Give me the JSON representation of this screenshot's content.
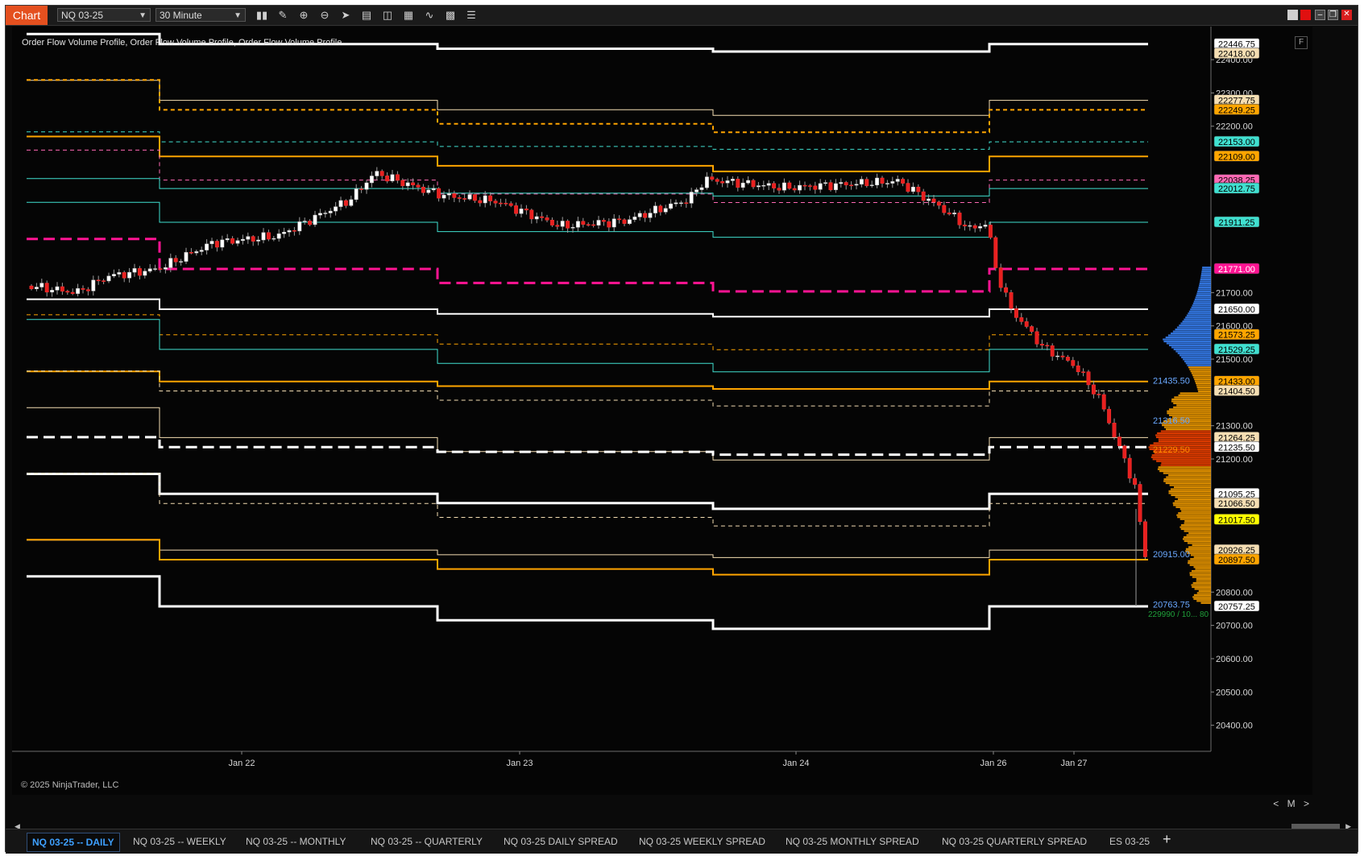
{
  "toolbar": {
    "title": "Chart",
    "instrument": "NQ 03-25",
    "interval": "30 Minute",
    "icons": [
      "bar-type-icon",
      "draw-tools-icon",
      "zoom-in-icon",
      "zoom-out-icon",
      "pointer-icon",
      "data-box-icon",
      "templates-icon",
      "properties-icon",
      "strategies-icon",
      "indicators-icon",
      "chart-trader-icon"
    ]
  },
  "indicator_label": "Order Flow Volume Profile, Order Flow Volume Profile, Order Flow Volume Profile",
  "copyright": "© 2025 NinjaTrader, LLC",
  "f_button": "F",
  "nav_buttons": [
    "<",
    "M",
    ">"
  ],
  "tabs": [
    {
      "label": "NQ 03-25 -- DAILY",
      "active": true
    },
    {
      "label": "NQ 03-25 -- WEEKLY",
      "active": false
    },
    {
      "label": "NQ 03-25 -- MONTHLY",
      "active": false
    },
    {
      "label": "NQ 03-25 -- QUARTERLY",
      "active": false
    },
    {
      "label": "NQ 03-25 DAILY SPREAD",
      "active": false
    },
    {
      "label": "NQ 03-25 WEEKLY SPREAD",
      "active": false
    },
    {
      "label": "NQ 03-25 MONTHLY SPREAD",
      "active": false
    },
    {
      "label": "NQ 03-25 QUARTERLY SPREAD",
      "active": false
    },
    {
      "label": "ES 03-25",
      "active": false
    }
  ],
  "add_tab": "+",
  "chart_data": {
    "type": "candlestick",
    "instrument": "NQ 03-25",
    "interval": "30 Minute",
    "ylim": [
      20370,
      22480
    ],
    "y_ticks": [
      22400.0,
      22300.0,
      22200.0,
      21700.0,
      21600.0,
      21500.0,
      21300.0,
      21200.0,
      20800.0,
      20700.0,
      20600.0,
      20500.0,
      20400.0
    ],
    "x_labels": [
      "Jan 22",
      "Jan 23",
      "Jan 24",
      "Jan 26",
      "Jan 27"
    ],
    "price_markers": [
      {
        "label": "22446.75",
        "value": 22446.75,
        "bg": "#ffffff",
        "fg": "#000000"
      },
      {
        "label": "22418.00",
        "value": 22418.0,
        "bg": "#f5deb3",
        "fg": "#000000"
      },
      {
        "label": "22277.75",
        "value": 22277.75,
        "bg": "#f5deb3",
        "fg": "#000000"
      },
      {
        "label": "22249.25",
        "value": 22249.25,
        "bg": "#ffa500",
        "fg": "#000000"
      },
      {
        "label": "22153.00",
        "value": 22153.0,
        "bg": "#40e0d0",
        "fg": "#000000"
      },
      {
        "label": "22109.00",
        "value": 22109.0,
        "bg": "#ffa500",
        "fg": "#000000"
      },
      {
        "label": "22038.25",
        "value": 22038.25,
        "bg": "#ff69b4",
        "fg": "#000000"
      },
      {
        "label": "22012.75",
        "value": 22012.75,
        "bg": "#40e0d0",
        "fg": "#000000"
      },
      {
        "label": "21911.25",
        "value": 21911.25,
        "bg": "#40e0d0",
        "fg": "#000000"
      },
      {
        "label": "21771.00",
        "value": 21771.0,
        "bg": "#ff1493",
        "fg": "#ffffff"
      },
      {
        "label": "21650.00",
        "value": 21650.0,
        "bg": "#ffffff",
        "fg": "#000000"
      },
      {
        "label": "21573.25",
        "value": 21573.25,
        "bg": "#ffa500",
        "fg": "#000000"
      },
      {
        "label": "21529.25",
        "value": 21529.25,
        "bg": "#40e0d0",
        "fg": "#000000"
      },
      {
        "label": "21433.00",
        "value": 21433.0,
        "bg": "#ffa500",
        "fg": "#000000"
      },
      {
        "label": "21404.50",
        "value": 21404.5,
        "bg": "#f5deb3",
        "fg": "#000000"
      },
      {
        "label": "21264.25",
        "value": 21264.25,
        "bg": "#f5deb3",
        "fg": "#000000"
      },
      {
        "label": "21235.50",
        "value": 21235.5,
        "bg": "#ffffff",
        "fg": "#000000"
      },
      {
        "label": "21095.25",
        "value": 21095.25,
        "bg": "#ffffff",
        "fg": "#000000"
      },
      {
        "label": "21066.50",
        "value": 21066.5,
        "bg": "#f5deb3",
        "fg": "#000000"
      },
      {
        "label": "21017.50",
        "value": 21017.5,
        "bg": "#ffff00",
        "fg": "#000000"
      },
      {
        "label": "20926.25",
        "value": 20926.25,
        "bg": "#f5deb3",
        "fg": "#000000"
      },
      {
        "label": "20897.50",
        "value": 20897.5,
        "bg": "#ffa500",
        "fg": "#000000"
      },
      {
        "label": "20757.25",
        "value": 20757.25,
        "bg": "#ffffff",
        "fg": "#000000"
      }
    ],
    "profile_labels": [
      {
        "label": "21435.50",
        "value": 21435.5,
        "color": "#6aa8ff"
      },
      {
        "label": "21316.50",
        "value": 21316.5,
        "color": "#6aa8ff"
      },
      {
        "label": "21229.50",
        "value": 21229.5,
        "color": "#ff8c00"
      },
      {
        "label": "20915.00",
        "value": 20915.0,
        "color": "#6aa8ff"
      },
      {
        "label": "20763.75",
        "value": 20763.75,
        "color": "#6aa8ff"
      }
    ],
    "volume_summary": "229990 / 10... 80",
    "level_lines": [
      {
        "color": "#ffffff",
        "style": "solid",
        "width": 3,
        "values": [
          22446.75,
          22446.75,
          22446.75,
          22446.75,
          22446.75
        ]
      },
      {
        "color": "#f5deb3",
        "style": "solid",
        "width": 1,
        "values": [
          22277.75,
          22277.75,
          22277.75,
          22277.75,
          22277.75
        ]
      },
      {
        "color": "#ffa500",
        "style": "dashed",
        "width": 2,
        "values": [
          22249.25,
          22249.25,
          22249.25,
          22249.25,
          22249.25
        ]
      },
      {
        "color": "#40e0d0",
        "style": "dashed",
        "width": 1,
        "values": [
          22153.0,
          22153.0,
          22153.0,
          22153.0,
          22153.0
        ]
      },
      {
        "color": "#ffa500",
        "style": "solid",
        "width": 2,
        "values": [
          22109.0,
          22109.0,
          22109.0,
          22109.0,
          22109.0
        ]
      },
      {
        "color": "#ff69b4",
        "style": "dashed",
        "width": 1,
        "values": [
          22038.25,
          22038.25,
          22038.25,
          22038.25,
          22038.25
        ]
      },
      {
        "color": "#40e0d0",
        "style": "solid",
        "width": 1,
        "values": [
          22012.75,
          22012.75,
          22012.75,
          22012.75,
          22012.75
        ]
      },
      {
        "color": "#40e0d0",
        "style": "solid",
        "width": 1,
        "values": [
          21911.25,
          21911.25,
          21911.25,
          21911.25,
          21911.25
        ]
      },
      {
        "color": "#ff1493",
        "style": "dashed",
        "width": 3,
        "values": [
          21771.0,
          21771.0,
          21771.0,
          21771.0,
          21771.0
        ]
      },
      {
        "color": "#ffffff",
        "style": "solid",
        "width": 2,
        "values": [
          21650.0,
          21650.0,
          21650.0,
          21650.0,
          21650.0
        ]
      },
      {
        "color": "#ffa500",
        "style": "dashed",
        "width": 1,
        "values": [
          21573.25,
          21573.25,
          21573.25,
          21573.25,
          21573.25
        ]
      },
      {
        "color": "#40e0d0",
        "style": "solid",
        "width": 1,
        "values": [
          21529.25,
          21529.25,
          21529.25,
          21529.25,
          21529.25
        ]
      },
      {
        "color": "#ffa500",
        "style": "solid",
        "width": 2,
        "values": [
          21433.0,
          21433.0,
          21433.0,
          21433.0,
          21433.0
        ]
      },
      {
        "color": "#f5deb3",
        "style": "dashed",
        "width": 1,
        "values": [
          21404.5,
          21404.5,
          21404.5,
          21404.5,
          21404.5
        ]
      },
      {
        "color": "#f5deb3",
        "style": "solid",
        "width": 1,
        "values": [
          21264.25,
          21264.25,
          21264.25,
          21264.25,
          21264.25
        ]
      },
      {
        "color": "#ffffff",
        "style": "dashed",
        "width": 3,
        "values": [
          21235.5,
          21235.5,
          21235.5,
          21235.5,
          21235.5
        ]
      },
      {
        "color": "#ffffff",
        "style": "solid",
        "width": 3,
        "values": [
          21095.25,
          21095.25,
          21095.25,
          21095.25,
          21095.25
        ]
      },
      {
        "color": "#f5deb3",
        "style": "dashed",
        "width": 1,
        "values": [
          21066.5,
          21066.5,
          21066.5,
          21066.5,
          21066.5
        ]
      },
      {
        "color": "#f5deb3",
        "style": "solid",
        "width": 1,
        "values": [
          20926.25,
          20926.25,
          20926.25,
          20926.25,
          20926.25
        ]
      },
      {
        "color": "#ffa500",
        "style": "solid",
        "width": 2,
        "values": [
          20897.5,
          20897.5,
          20897.5,
          20897.5,
          20897.5
        ]
      },
      {
        "color": "#ffffff",
        "style": "solid",
        "width": 3,
        "values": [
          20757.25,
          20757.25,
          20757.25,
          20757.25,
          20757.25
        ]
      }
    ]
  }
}
